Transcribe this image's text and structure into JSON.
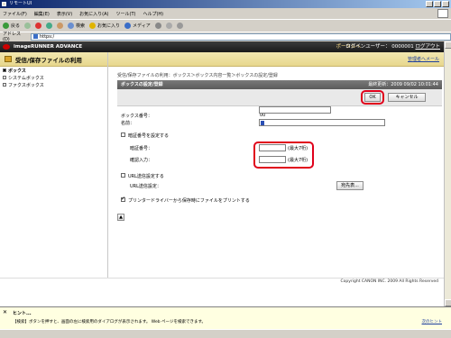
{
  "window": {
    "title": "リモートUI"
  },
  "menu": [
    "ファイル(F)",
    "編集(E)",
    "表示(V)",
    "お気に入り(A)",
    "ツール(T)",
    "ヘルプ(H)"
  ],
  "toolbar": {
    "back": "戻る",
    "search": "検索",
    "favorites": "お気に入り",
    "media": "メディア"
  },
  "address": {
    "label": "アドレス(D)",
    "url": "https:/"
  },
  "app": {
    "product": "imageRUNNER ADVANCE",
    "portal_link": "ポータルへ",
    "login_user_label": "ログインユーザー： 0000001",
    "logout": "ログアウト",
    "admin_mail": "管理者へメール"
  },
  "sidebar": {
    "title": "受信/保存ファイルの利用",
    "items": [
      {
        "label": "ボックス"
      },
      {
        "label": "システムボックス"
      },
      {
        "label": "ファクスボックス"
      }
    ]
  },
  "breadcrumb": "受信/保存ファイルの利用：ボックス＞ボックス内容一覧＞ボックスの設定/登録",
  "panel": {
    "title": "ボックスの設定/登録",
    "updated": "最終更新：2009 09/02 10:01:44",
    "ok": "OK",
    "cancel": "キャンセル"
  },
  "form": {
    "box_number_label": "ボックス番号：",
    "box_number_value": "00",
    "name_label": "名前：",
    "pin_set_label": "暗証番号を設定する",
    "pin_label": "暗証番号：",
    "pin_confirm_label": "確認入力：",
    "max_note": "(最大7桁)",
    "url_send_label": "URL送信設定する",
    "url_dest_label": "URL送信設定：",
    "address_book_button": "宛先表...",
    "print_option_label": "プリンタードライバーから保存時にファイルをプリントする"
  },
  "copyright": "Copyright CANON INC. 2009 All Rights Reserved",
  "hint": {
    "title": "ヒント...",
    "text": "【検索】ボタンを押すと、画面の左に検索用のダイアログが表示されます。 Web ページを検索できます。",
    "next": "次のヒント"
  },
  "colors": {
    "highlight": "#e0001b",
    "accent_bar": "#e7d78d"
  }
}
